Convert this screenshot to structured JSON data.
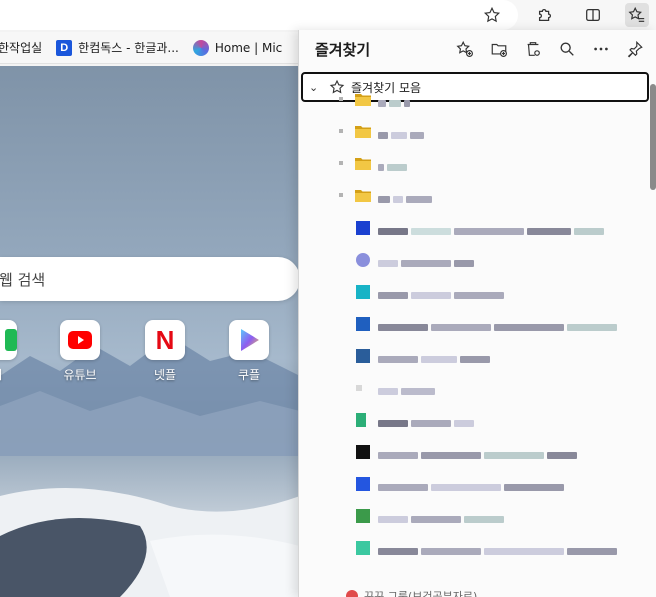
{
  "toolbar": {
    "icons": [
      "star-outline-icon",
      "extensions-puzzle-icon",
      "split-screen-icon",
      "favorites-icon"
    ]
  },
  "favbar": {
    "items": [
      {
        "label": "한작업실",
        "icon": "none"
      },
      {
        "label": "한컴독스 - 한글과...",
        "icon": "docs-d-icon",
        "badge": "D"
      },
      {
        "label": "Home | Mic",
        "icon": "microsoft-365-icon"
      }
    ]
  },
  "page": {
    "search_placeholder": "웹 검색",
    "tiles": [
      {
        "label": "버",
        "icon": "green-app-icon"
      },
      {
        "label": "유튜브",
        "icon": "youtube-icon"
      },
      {
        "label": "넷플",
        "icon": "netflix-icon",
        "glyph": "N"
      },
      {
        "label": "쿠플",
        "icon": "coupang-play-icon"
      }
    ]
  },
  "panel": {
    "title": "즐겨찾기",
    "actions": [
      "add-favorite-icon",
      "add-folder-icon",
      "manage-favorites-icon",
      "search-icon",
      "more-icon",
      "pin-icon"
    ],
    "root_label": "즐겨찾기 모음",
    "bottom_text": "꾸꾸 그룹(보건공부자료)"
  },
  "colors": {
    "accent": "#1a56db",
    "youtube": "#ff0000",
    "netflix": "#e50914",
    "folder": "#d4a017"
  }
}
